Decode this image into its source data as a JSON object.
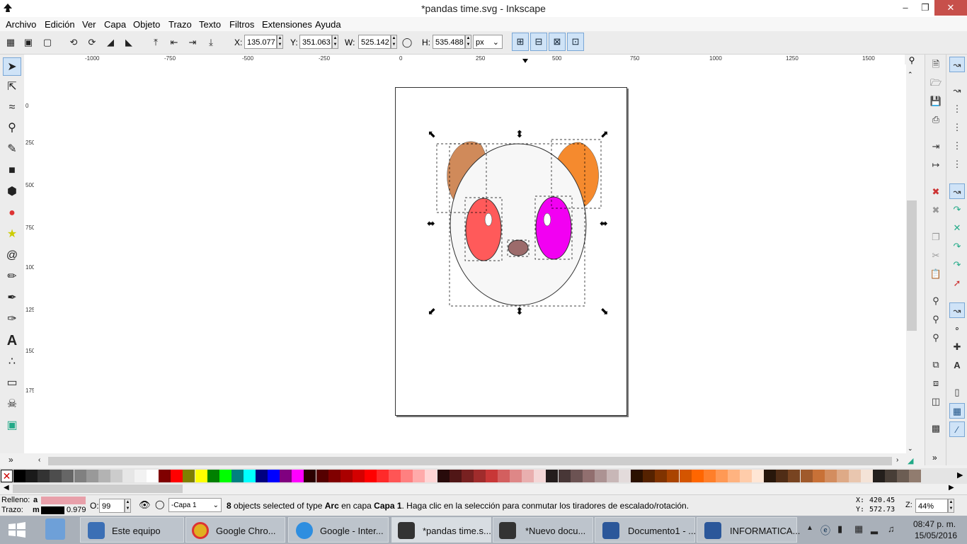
{
  "window": {
    "title": "*pandas time.svg - Inkscape"
  },
  "menu": [
    "Archivo",
    "Edición",
    "Ver",
    "Capa",
    "Objeto",
    "Trazo",
    "Texto",
    "Filtros",
    "Extensiones",
    "Ayuda"
  ],
  "toolbar": {
    "x_label": "X:",
    "x_value": "135.077",
    "y_label": "Y:",
    "y_value": "351.063",
    "w_label": "W:",
    "w_value": "525.142",
    "h_label": "H:",
    "h_value": "535.488",
    "unit": "px"
  },
  "ruler": {
    "h_labels": [
      "-1000",
      "-750",
      "-500",
      "-250",
      "0",
      "250",
      "500",
      "750",
      "1000",
      "1250",
      "1500"
    ],
    "v_labels": [
      "0",
      "250",
      "500",
      "750",
      "1000",
      "1250",
      "1500",
      "1750"
    ]
  },
  "drawing": {
    "colors": {
      "left_ear": "#d08a5a",
      "right_ear": "#f58a2e",
      "face": "#f7f7f7",
      "left_eye": "#ff5a5a",
      "right_eye": "#f200f2",
      "nose": "#9c6b6b",
      "stroke": "#333333"
    }
  },
  "palette_colors": [
    "#000000",
    "#1a1a1a",
    "#333333",
    "#4d4d4d",
    "#666666",
    "#808080",
    "#999999",
    "#b3b3b3",
    "#cccccc",
    "#e6e6e6",
    "#f2f2f2",
    "#ffffff",
    "#800000",
    "#ff0000",
    "#808000",
    "#ffff00",
    "#008000",
    "#00ff00",
    "#008080",
    "#00ffff",
    "#000080",
    "#0000ff",
    "#800080",
    "#ff00ff",
    "#2b0000",
    "#550000",
    "#800000",
    "#aa0000",
    "#d40000",
    "#ff0000",
    "#ff2a2a",
    "#ff5555",
    "#ff8080",
    "#ffaaaa",
    "#ffd5d5",
    "#280b0b",
    "#501616",
    "#782121",
    "#a02c2c",
    "#c83737",
    "#d35f5f",
    "#de8787",
    "#e9afaf",
    "#f4d7d7",
    "#241c1c",
    "#483737",
    "#6c5353",
    "#916f6f",
    "#ac9393",
    "#c8b7b7",
    "#e3dbdb",
    "#2b1100",
    "#552200",
    "#803300",
    "#aa4400",
    "#d45500",
    "#ff6600",
    "#ff7f2a",
    "#ff9955",
    "#ffb380",
    "#ffccaa",
    "#ffe6d5",
    "#28170b",
    "#502d16",
    "#784421",
    "#a05a2c",
    "#c87137",
    "#d38d5f",
    "#deaa87",
    "#e9c6af",
    "#f4e3d7",
    "#241f1c",
    "#483e37",
    "#6c5d53",
    "#917c6f"
  ],
  "status": {
    "fill_label": "Relleno:",
    "fill_value": "a",
    "stroke_label": "Trazo:",
    "stroke_value": "m",
    "stroke_width": "0.979",
    "opacity_label": "O:",
    "opacity_value": "99",
    "layer": "-Capa 1",
    "count": "8",
    "msg_1": " objects selected of type ",
    "msg_type": "Arc",
    "msg_2": " en capa ",
    "msg_layer": "Capa 1",
    "msg_3": ". Haga clic en la selección para conmutar los tiradores de escalado/rotación.",
    "cursor_x_label": "X:",
    "cursor_x": "420.45",
    "cursor_y_label": "Y:",
    "cursor_y": "572.73",
    "zoom_label": "Z:",
    "zoom": "44%"
  },
  "taskbar": {
    "items": [
      "Este equipo",
      "Google Chro...",
      "Google - Inter...",
      "*pandas time.s...",
      "*Nuevo docu...",
      "Documento1 - ...",
      "INFORMATICA..."
    ],
    "time": "08:47 p. m.",
    "date": "15/05/2016"
  }
}
